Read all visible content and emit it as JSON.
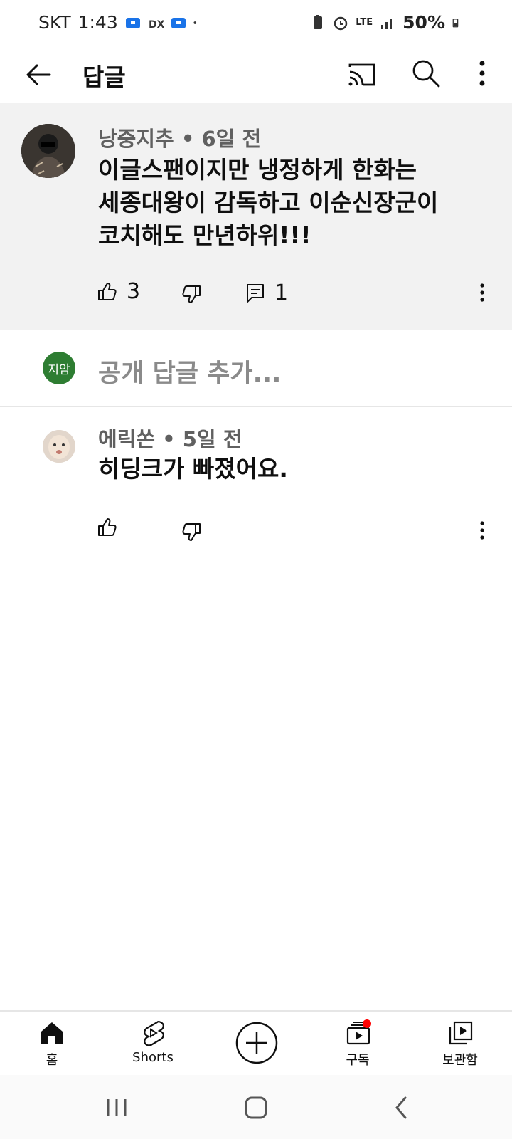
{
  "status_bar": {
    "carrier": "SKT",
    "time": "1:43",
    "network": "LTE",
    "battery": "50%"
  },
  "header": {
    "title": "답글",
    "icons": [
      "back-arrow-icon",
      "cast-icon",
      "search-icon",
      "more-vert-icon"
    ]
  },
  "parent_comment": {
    "author": "낭중지추",
    "time_ago": "6일 전",
    "text_lines": [
      "이글스팬이지만 냉정하게 한화는",
      "세종대왕이 감독하고 이순신장군이",
      "코치해도 만년하위!!!"
    ],
    "likes": "3",
    "replies": "1"
  },
  "reply_input": {
    "avatar_text": "지암",
    "placeholder": "공개 답글 추가..."
  },
  "replies": [
    {
      "author": "에릭쏜",
      "time_ago": "5일 전",
      "text": "히딩크가 빠졌어요."
    }
  ],
  "bottom_nav": {
    "home": "홈",
    "shorts": "Shorts",
    "subscriptions": "구독",
    "library": "보관함"
  },
  "colors": {
    "accent_red": "#ff0000",
    "avatar_green": "#2e7d32",
    "parent_bg": "#f2f2f2"
  }
}
